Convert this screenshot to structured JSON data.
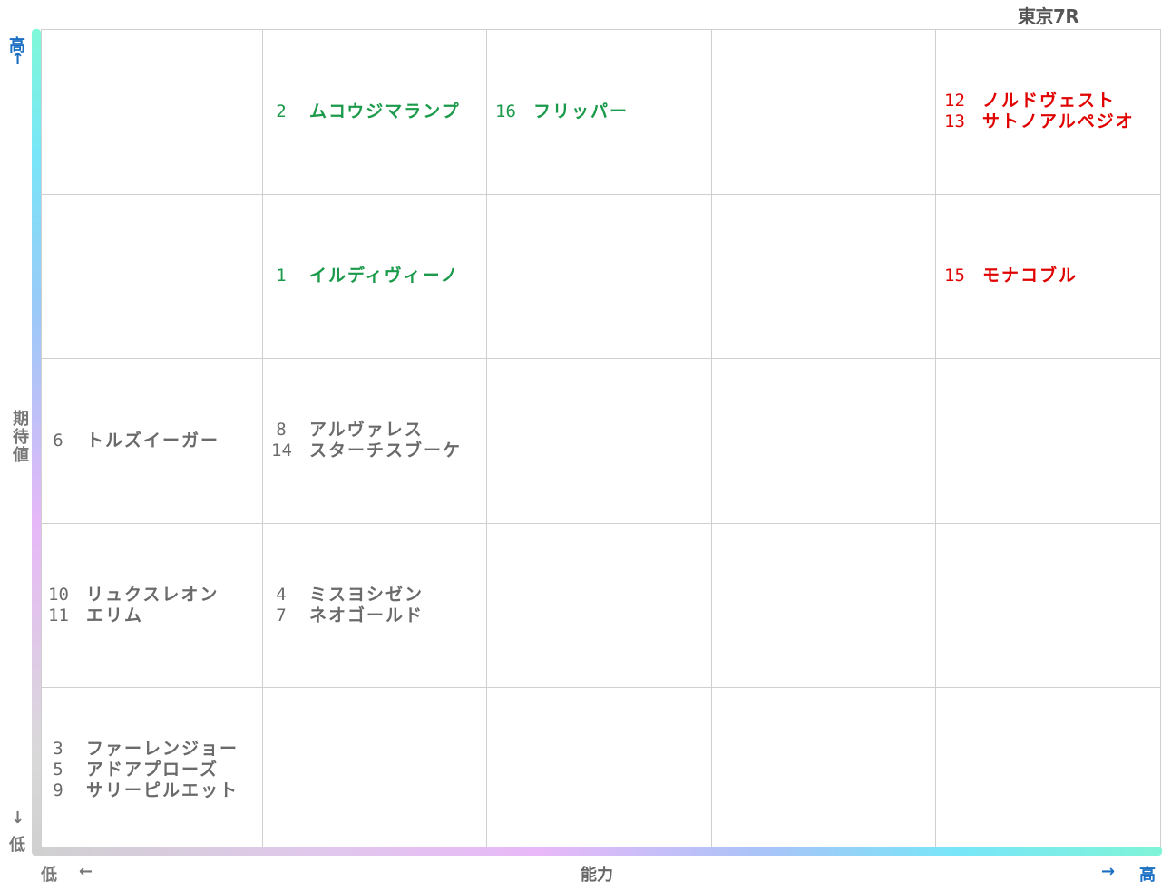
{
  "title": "東京7R",
  "axes": {
    "y_label": "期待値",
    "y_high": "高",
    "y_high_arrow": "↑",
    "y_low": "低",
    "y_low_arrow": "↓",
    "x_label": "能力",
    "x_low": "低",
    "x_low_arrow": "←",
    "x_high": "高",
    "x_high_arrow": "→"
  },
  "colors": {
    "gray": "#6a6a6a",
    "green": "#1a9a4a",
    "red": "#e00000",
    "accent_blue": "#1a6fc2"
  },
  "grid": {
    "columns": 5,
    "rows": 5,
    "cells": [
      {
        "col": 1,
        "row": 0,
        "entries": [
          {
            "num": "2",
            "name": "ムコウジマランプ",
            "color": "green"
          }
        ]
      },
      {
        "col": 2,
        "row": 0,
        "entries": [
          {
            "num": "16",
            "name": "フリッパー",
            "color": "green"
          }
        ]
      },
      {
        "col": 4,
        "row": 0,
        "entries": [
          {
            "num": "12",
            "name": "ノルドヴェスト",
            "color": "red"
          },
          {
            "num": "13",
            "name": "サトノアルペジオ",
            "color": "red"
          }
        ]
      },
      {
        "col": 1,
        "row": 1,
        "entries": [
          {
            "num": "1",
            "name": "イルディヴィーノ",
            "color": "green"
          }
        ]
      },
      {
        "col": 4,
        "row": 1,
        "entries": [
          {
            "num": "15",
            "name": "モナコブル",
            "color": "red"
          }
        ]
      },
      {
        "col": 0,
        "row": 2,
        "entries": [
          {
            "num": "6",
            "name": "トルズイーガー",
            "color": "gray"
          }
        ]
      },
      {
        "col": 1,
        "row": 2,
        "entries": [
          {
            "num": "8",
            "name": "アルヴァレス",
            "color": "gray"
          },
          {
            "num": "14",
            "name": "スターチスブーケ",
            "color": "gray"
          }
        ]
      },
      {
        "col": 0,
        "row": 3,
        "entries": [
          {
            "num": "10",
            "name": "リュクスレオン",
            "color": "gray"
          },
          {
            "num": "11",
            "name": "エリム",
            "color": "gray"
          }
        ]
      },
      {
        "col": 1,
        "row": 3,
        "entries": [
          {
            "num": "4",
            "name": "ミスヨシゼン",
            "color": "gray"
          },
          {
            "num": "7",
            "name": "ネオゴールド",
            "color": "gray"
          }
        ]
      },
      {
        "col": 0,
        "row": 4,
        "entries": [
          {
            "num": "3",
            "name": "ファーレンジョー",
            "color": "gray"
          },
          {
            "num": "5",
            "name": "アドアプローズ",
            "color": "gray"
          },
          {
            "num": "9",
            "name": "サリーピルエット",
            "color": "gray"
          }
        ]
      }
    ]
  }
}
